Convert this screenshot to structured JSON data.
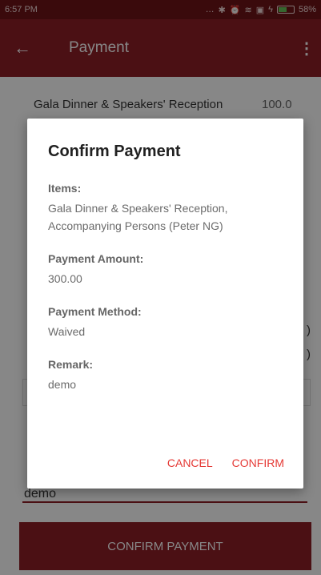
{
  "status_bar": {
    "time": "6:57 PM",
    "icons": [
      "signal-dots-icon",
      "bluetooth-icon",
      "alarm-icon",
      "wifi-icon",
      "sim-icon",
      "charging-icon"
    ],
    "battery_percent": "58%",
    "battery_level": 0.58
  },
  "app_bar": {
    "title": "Payment",
    "back_icon": "←",
    "more_icon": "⋮"
  },
  "background": {
    "item_name": "Gala Dinner & Speakers' Reception",
    "item_amount": "100.0",
    "paren_1": ")",
    "paren_2": ")",
    "remark_value": "demo",
    "confirm_payment_label": "CONFIRM PAYMENT"
  },
  "dialog": {
    "title": "Confirm Payment",
    "items_label": "Items:",
    "items_value": "Gala Dinner & Speakers' Reception, Accompanying Persons (Peter NG)",
    "amount_label": "Payment Amount:",
    "amount_value": "300.00",
    "method_label": "Payment Method:",
    "method_value": "Waived",
    "remark_label": "Remark:",
    "remark_value": "demo",
    "cancel_label": "CANCEL",
    "confirm_label": "CONFIRM"
  },
  "colors": {
    "primary": "#8f1f27",
    "status_bar": "#6e1418",
    "accent": "#e53935"
  }
}
